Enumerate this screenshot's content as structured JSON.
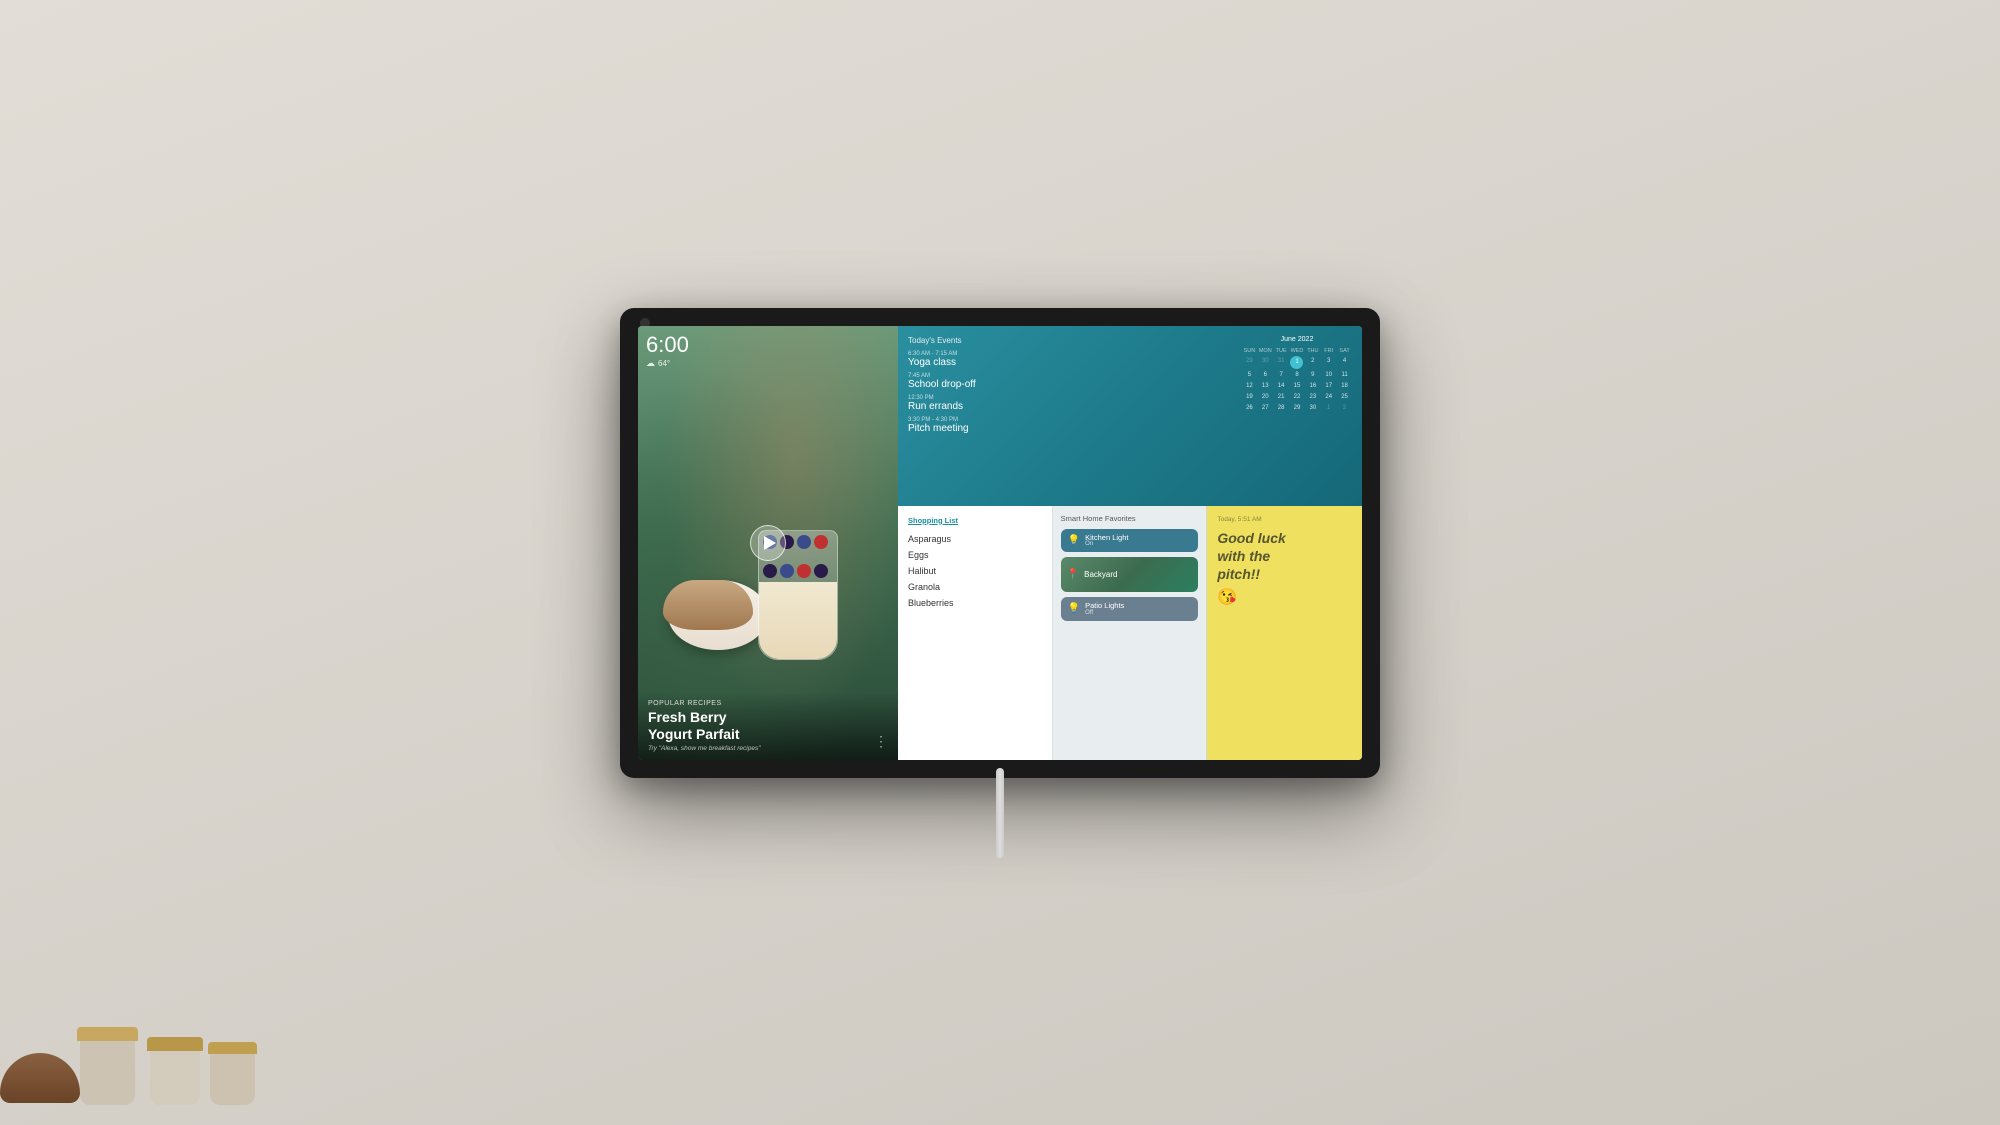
{
  "device": {
    "time": "6:00",
    "weather": {
      "temp": "64°",
      "icon": "☁"
    }
  },
  "hero": {
    "category": "Popular Recipes",
    "title": "Fresh Berry\nYogurt Parfait",
    "subtitle": "Try \"Alexa, show me breakfast recipes\""
  },
  "calendar": {
    "title": "Today's Events",
    "month": "June 2022",
    "events": [
      {
        "time": "6:30 AM - 7:15 AM",
        "name": "Yoga class"
      },
      {
        "time": "7:45 AM",
        "name": "School drop-off"
      },
      {
        "time": "12:30 PM",
        "name": "Run errands"
      },
      {
        "time": "3:30 PM - 4:30 PM",
        "name": "Pitch meeting"
      }
    ],
    "headers": [
      "SUN",
      "MON",
      "TUE",
      "WED",
      "THU",
      "FRI",
      "SAT"
    ],
    "weeks": [
      [
        "29",
        "30",
        "31",
        "1",
        "2",
        "3",
        "4"
      ],
      [
        "5",
        "6",
        "7",
        "8",
        "9",
        "10",
        "11"
      ],
      [
        "12",
        "13",
        "14",
        "15",
        "16",
        "17",
        "18"
      ],
      [
        "19",
        "20",
        "21",
        "22",
        "23",
        "24",
        "25"
      ],
      [
        "26",
        "27",
        "28",
        "29",
        "30",
        "1",
        "2"
      ]
    ],
    "today": "1"
  },
  "shopping": {
    "title": "Shopping List",
    "items": [
      "Asparagus",
      "Eggs",
      "Halibut",
      "Granola",
      "Blueberries"
    ]
  },
  "smarthome": {
    "title": "Smart Home Favorites",
    "devices": [
      {
        "name": "Kitchen Light",
        "status": "On",
        "icon": "💡",
        "state": "on"
      },
      {
        "name": "Backyard",
        "status": "",
        "icon": "📍",
        "state": "backyard"
      },
      {
        "name": "Patio Lights",
        "status": "Off",
        "icon": "💡",
        "state": "off"
      }
    ]
  },
  "note": {
    "time": "Today, 5:51 AM",
    "text": "Good luck\nwith the\npitch!!",
    "emoji": "😘"
  }
}
